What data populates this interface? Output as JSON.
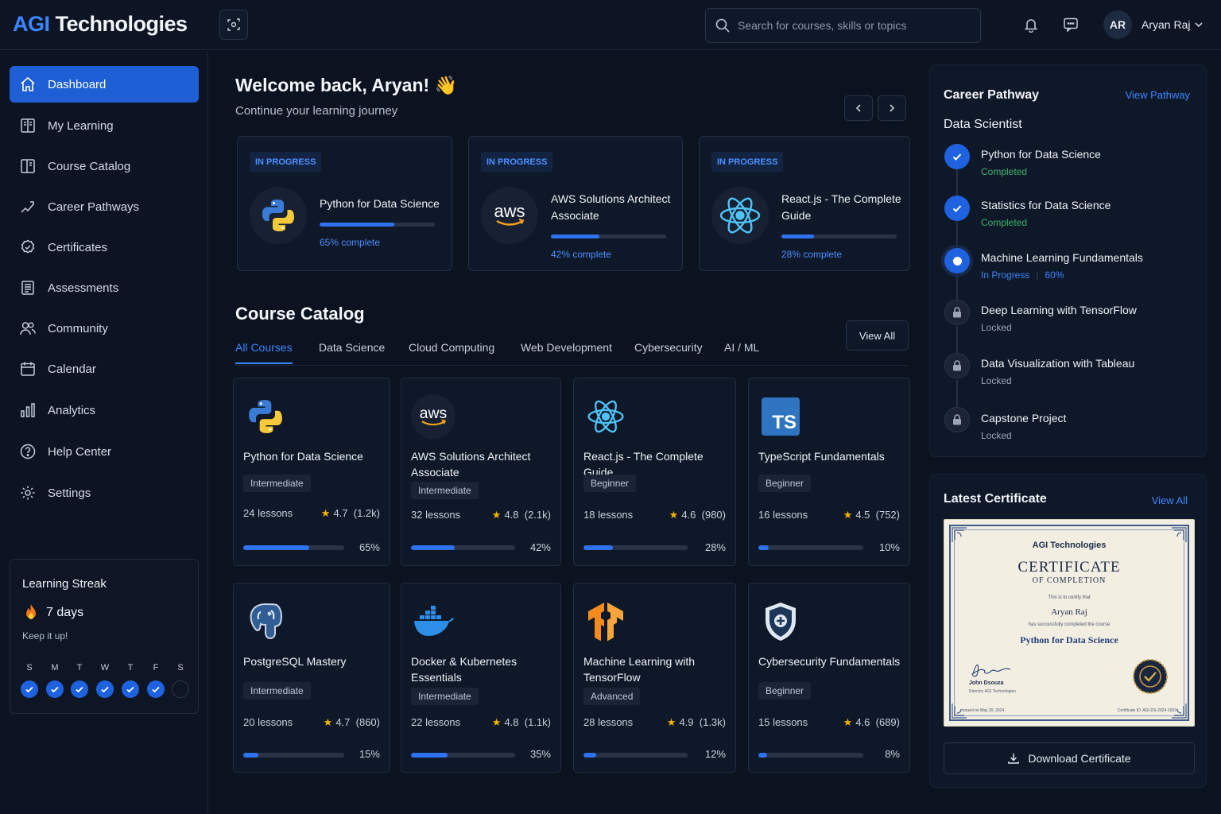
{
  "app": {
    "logo_prefix": "AGI",
    "logo_suffix": "Technologies",
    "accent": "#2d72f0"
  },
  "header": {
    "search_placeholder": "Search for courses, skills or topics",
    "user_initials": "AR",
    "user_name": "Aryan Raj",
    "icons": [
      "scan-icon",
      "search-icon",
      "bell-icon",
      "chat-icon",
      "chevron-down-icon"
    ]
  },
  "sidebar": {
    "items": [
      {
        "label": "Dashboard",
        "icon": "home-icon",
        "active": true
      },
      {
        "label": "My Learning",
        "icon": "book-icon"
      },
      {
        "label": "Course Catalog",
        "icon": "catalog-icon"
      },
      {
        "label": "Career Pathways",
        "icon": "trend-icon"
      },
      {
        "label": "Certificates",
        "icon": "badge-icon"
      },
      {
        "label": "Assessments",
        "icon": "clipboard-icon"
      },
      {
        "label": "Community",
        "icon": "users-icon"
      },
      {
        "label": "Calendar",
        "icon": "calendar-icon"
      },
      {
        "label": "Analytics",
        "icon": "chart-icon"
      },
      {
        "label": "Help Center",
        "icon": "help-icon"
      },
      {
        "label": "Settings",
        "icon": "gear-icon"
      }
    ],
    "streak": {
      "title": "Learning Streak",
      "days": "7 days",
      "subtitle": "Keep it up!",
      "weekdays": [
        "S",
        "M",
        "T",
        "W",
        "T",
        "F",
        "S"
      ],
      "completed": [
        true,
        true,
        true,
        true,
        true,
        true,
        false
      ]
    }
  },
  "main": {
    "welcome": "Welcome back, Aryan! 👋",
    "welcome_sub": "Continue your learning journey",
    "in_progress": [
      {
        "badge": "IN PROGRESS",
        "title": "Python for Data Science",
        "progress": 0.65,
        "pct_label": "65% complete",
        "icon": "python-logo-icon"
      },
      {
        "badge": "IN PROGRESS",
        "title": "AWS Solutions Architect Associate",
        "progress": 0.42,
        "pct_label": "42% complete",
        "icon": "aws-logo-icon"
      },
      {
        "badge": "IN PROGRESS",
        "title": "React.js - The Complete Guide",
        "progress": 0.28,
        "pct_label": "28% complete",
        "icon": "react-logo-icon"
      }
    ],
    "catalog": {
      "title": "Course Catalog",
      "view_all": "View All",
      "tabs": [
        "All Courses",
        "Data Science",
        "Cloud Computing",
        "Web Development",
        "Cybersecurity",
        "AI / ML"
      ],
      "courses": [
        {
          "title": "Python for Data Science",
          "level": "Intermediate",
          "lessons": "24 lessons",
          "rating": "4.7",
          "reviews": "(1.2k)",
          "progress": 0.65,
          "pct": "65%",
          "icon": "python-logo-icon"
        },
        {
          "title": "AWS Solutions Architect Associate",
          "level": "Intermediate",
          "lessons": "32 lessons",
          "rating": "4.8",
          "reviews": "(2.1k)",
          "progress": 0.42,
          "pct": "42%",
          "icon": "aws-logo-icon"
        },
        {
          "title": "React.js - The Complete Guide",
          "level": "Beginner",
          "lessons": "18 lessons",
          "rating": "4.6",
          "reviews": "(980)",
          "progress": 0.28,
          "pct": "28%",
          "icon": "react-logo-icon"
        },
        {
          "title": "TypeScript Fundamentals",
          "level": "Beginner",
          "lessons": "16 lessons",
          "rating": "4.5",
          "reviews": "(752)",
          "progress": 0.1,
          "pct": "10%",
          "icon": "typescript-logo-icon",
          "logo_text": "TS"
        },
        {
          "title": "PostgreSQL Mastery",
          "level": "Intermediate",
          "lessons": "20 lessons",
          "rating": "4.7",
          "reviews": "(860)",
          "progress": 0.15,
          "pct": "15%",
          "icon": "postgresql-logo-icon"
        },
        {
          "title": "Docker & Kubernetes Essentials",
          "level": "Intermediate",
          "lessons": "22 lessons",
          "rating": "4.8",
          "reviews": "(1.1k)",
          "progress": 0.35,
          "pct": "35%",
          "icon": "docker-logo-icon"
        },
        {
          "title": "Machine Learning with TensorFlow",
          "level": "Advanced",
          "lessons": "28 lessons",
          "rating": "4.9",
          "reviews": "(1.3k)",
          "progress": 0.12,
          "pct": "12%",
          "icon": "tensorflow-logo-icon"
        },
        {
          "title": "Cybersecurity Fundamentals",
          "level": "Beginner",
          "lessons": "15 lessons",
          "rating": "4.6",
          "reviews": "(689)",
          "progress": 0.08,
          "pct": "8%",
          "icon": "shield-icon"
        }
      ]
    }
  },
  "career": {
    "title": "Career Pathway",
    "link": "View Pathway",
    "role": "Data Scientist",
    "steps": [
      {
        "title": "Python for Data Science",
        "status": "Completed",
        "state": "done"
      },
      {
        "title": "Statistics for Data Science",
        "status": "Completed",
        "state": "done"
      },
      {
        "title": "Machine Learning Fundamentals",
        "status": "In Progress",
        "extra": "60%",
        "state": "progress"
      },
      {
        "title": "Deep Learning with TensorFlow",
        "status": "Locked",
        "state": "locked"
      },
      {
        "title": "Data Visualization with Tableau",
        "status": "Locked",
        "state": "locked"
      },
      {
        "title": "Capstone Project",
        "status": "Locked",
        "state": "locked"
      }
    ]
  },
  "certificate": {
    "title": "Latest Certificate",
    "link": "View All",
    "issuer": "AGI Technologies",
    "heading": "CERTIFICATE",
    "subheading": "OF COMPLETION",
    "certify": "This is to certify that",
    "recipient": "Aryan Raj",
    "completed_text": "has successfully completed the course",
    "course": "Python for Data Science",
    "signer": "John Dsouza",
    "signer_role": "Director, AGI Technologies",
    "issued": "Issued on May 20, 2024",
    "cert_id": "Certificate ID: AGI-DS-2024-1003",
    "download": "Download Certificate"
  }
}
